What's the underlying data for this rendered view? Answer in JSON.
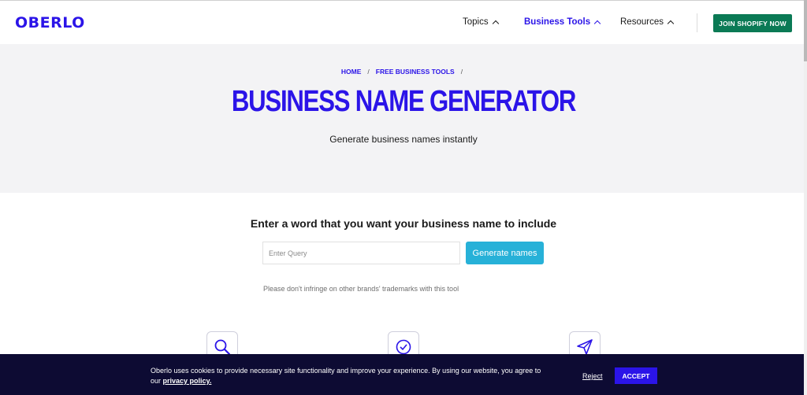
{
  "header": {
    "logo": "OBERLO",
    "nav": [
      {
        "label": "Topics"
      },
      {
        "label": "Business Tools"
      },
      {
        "label": "Resources"
      }
    ],
    "cta_label": "JOIN SHOPIFY NOW"
  },
  "hero": {
    "breadcrumb": [
      "HOME",
      "FREE BUSINESS TOOLS"
    ],
    "breadcrumb_sep": "/",
    "title": "BUSINESS NAME GENERATOR",
    "subtitle": "Generate business names instantly"
  },
  "form": {
    "prompt": "Enter a word that you want your business name to include",
    "placeholder": "Enter Query",
    "value": "",
    "button_label": "Generate names",
    "disclaimer": "Please don't infringe on other brands' trademarks with this tool"
  },
  "features": {
    "icons": [
      "search-icon",
      "checkmark-icon",
      "paper-plane-icon"
    ]
  },
  "cookie": {
    "text": "Oberlo uses cookies to provide necessary site functionality and improve your experience. By using our website, you agree to our",
    "link_label": "privacy policy.",
    "reject_label": "Reject",
    "accept_label": "ACCEPT"
  },
  "colors": {
    "brand": "#2b14e8",
    "cta_green": "#0b7a55",
    "generate_button": "#27b1d8",
    "hero_bg": "#f3f3f5",
    "cookie_bg": "#0d0b33"
  }
}
